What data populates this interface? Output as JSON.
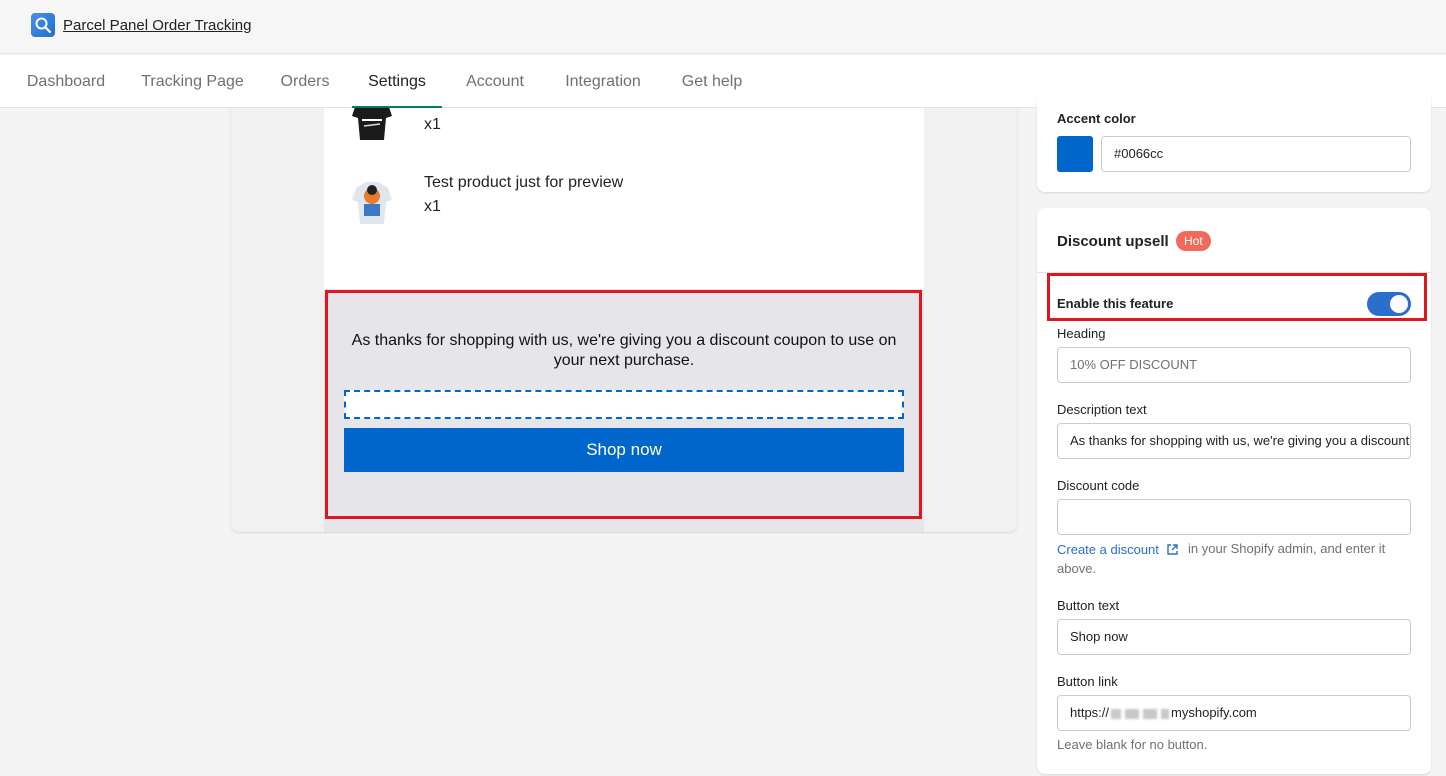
{
  "app": {
    "title": "Parcel Panel Order Tracking",
    "logo_icon": "search-icon"
  },
  "tabs": [
    {
      "label": "Dashboard"
    },
    {
      "label": "Tracking Page"
    },
    {
      "label": "Orders"
    },
    {
      "label": "Settings",
      "active": true
    },
    {
      "label": "Account"
    },
    {
      "label": "Integration"
    },
    {
      "label": "Get help"
    }
  ],
  "preview": {
    "products": [
      {
        "name": "",
        "qty": "x1"
      },
      {
        "name": "Test product just for preview",
        "qty": "x1"
      }
    ],
    "upsell": {
      "description": "As thanks for shopping with us, we're giving you a discount coupon to use on your next purchase.",
      "coupon_code": "",
      "button_label": "Shop now"
    }
  },
  "settings": {
    "accent": {
      "label": "Accent color",
      "value": "#0066cc",
      "color": "#0066cc"
    },
    "discount_upsell": {
      "title": "Discount upsell",
      "badge": "Hot",
      "enable_label": "Enable this feature",
      "enabled": true,
      "heading": {
        "label": "Heading",
        "placeholder": "10% OFF DISCOUNT",
        "value": ""
      },
      "description": {
        "label": "Description text",
        "value": "As thanks for shopping with us, we're giving you a discount coupon to use on your next purchase."
      },
      "discount_code": {
        "label": "Discount code",
        "value": ""
      },
      "create_link": "Create a discount",
      "create_help": "in your Shopify admin, and enter it above.",
      "button_text": {
        "label": "Button text",
        "value": "Shop now"
      },
      "button_link": {
        "label": "Button link",
        "prefix": "https://",
        "suffix": "myshopify.com",
        "help": "Leave blank for no button."
      }
    }
  }
}
